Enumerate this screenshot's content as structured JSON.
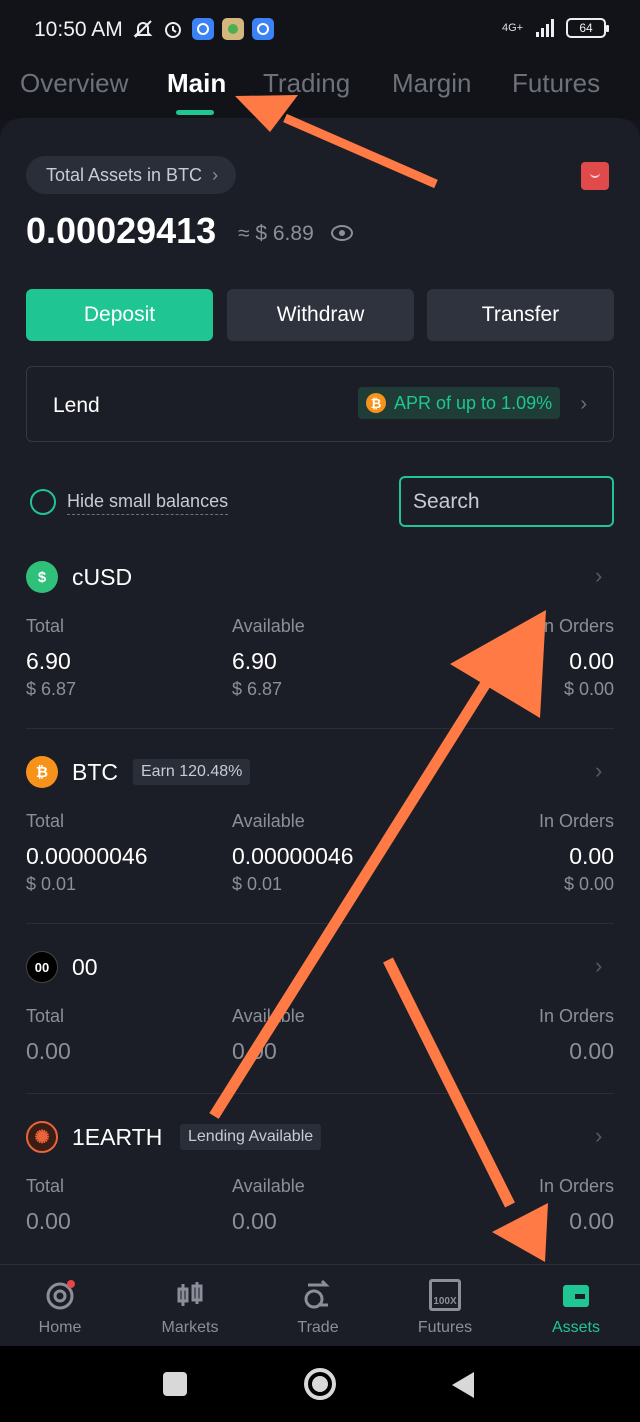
{
  "status_bar": {
    "time": "10:50 AM",
    "network": "4G+",
    "battery": "64"
  },
  "tabs": [
    {
      "label": "Overview"
    },
    {
      "label": "Main"
    },
    {
      "label": "Trading"
    },
    {
      "label": "Margin"
    },
    {
      "label": "Futures"
    }
  ],
  "header": {
    "total_assets_label": "Total Assets in BTC",
    "balance_btc": "0.00029413",
    "balance_usd": "≈ $ 6.89"
  },
  "actions": {
    "deposit": "Deposit",
    "withdraw": "Withdraw",
    "transfer": "Transfer"
  },
  "lend": {
    "label": "Lend",
    "apr_text": "APR of up to 1.09%",
    "apr_icon": "₿"
  },
  "filter": {
    "hide_small": "Hide small balances",
    "search_placeholder": "Search"
  },
  "columns": {
    "total": "Total",
    "available": "Available",
    "in_orders": "In Orders"
  },
  "assets": [
    {
      "name": "cUSD",
      "tag": "",
      "icon": "$",
      "total": "6.90",
      "total_usd": "$ 6.87",
      "available": "6.90",
      "available_usd": "$ 6.87",
      "in_orders": "0.00",
      "in_orders_usd": "$ 0.00"
    },
    {
      "name": "BTC",
      "tag": "Earn 120.48%",
      "icon": "₿",
      "total": "0.00000046",
      "total_usd": "$ 0.01",
      "available": "0.00000046",
      "available_usd": "$ 0.01",
      "in_orders": "0.00",
      "in_orders_usd": "$ 0.00"
    },
    {
      "name": "00",
      "tag": "",
      "icon": "00",
      "total": "0.00",
      "total_usd": "",
      "available": "0.00",
      "available_usd": "",
      "in_orders": "0.00",
      "in_orders_usd": ""
    },
    {
      "name": "1EARTH",
      "tag": "Lending Available",
      "icon": "✺",
      "total": "0.00",
      "total_usd": "",
      "available": "0.00",
      "available_usd": "",
      "in_orders": "0.00",
      "in_orders_usd": ""
    }
  ],
  "bottom_nav": [
    {
      "label": "Home"
    },
    {
      "label": "Markets"
    },
    {
      "label": "Trade"
    },
    {
      "label": "Futures",
      "badge": "100X"
    },
    {
      "label": "Assets"
    }
  ],
  "colors": {
    "accent": "#1fc593",
    "annotation_arrow": "#ff7a45",
    "background": "#1b1e26"
  }
}
